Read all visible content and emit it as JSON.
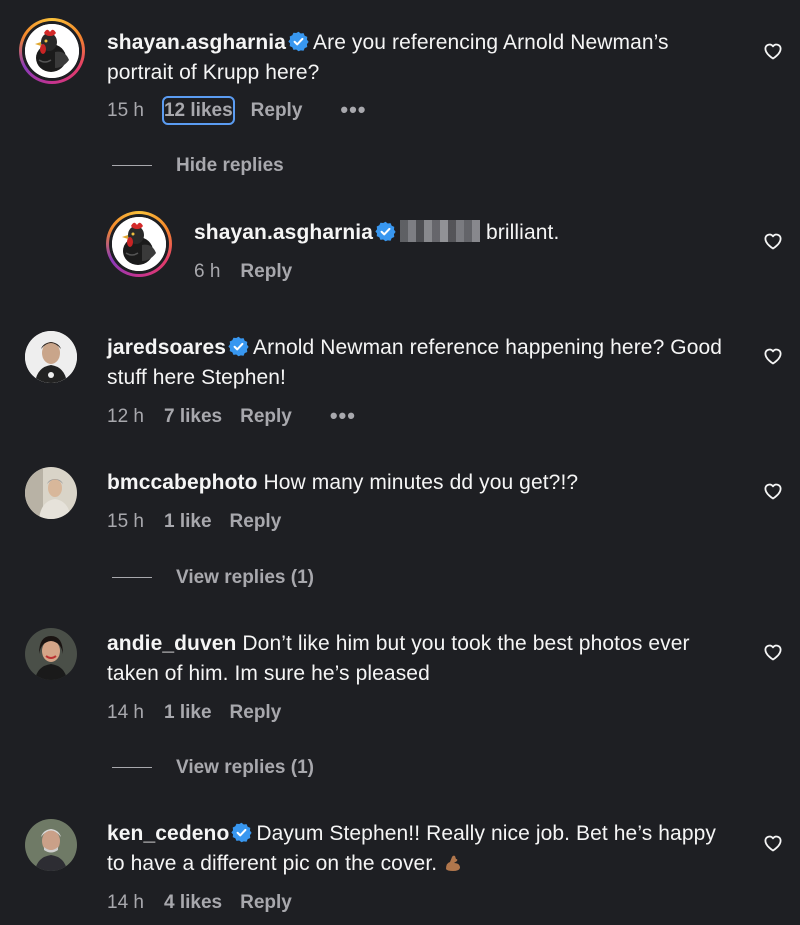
{
  "comments": [
    {
      "username": "shayan.asgharnia",
      "verified": true,
      "text": "Are you referencing Arnold Newman’s portrait of Krupp here?",
      "time": "15 h",
      "likes": "12 likes",
      "reply_label": "Reply",
      "more_label": "•••"
    },
    {
      "username": "shayan.asgharnia",
      "verified": true,
      "text": "brilliant.",
      "time": "6 h",
      "reply_label": "Reply"
    },
    {
      "username": "jaredsoares",
      "verified": true,
      "text": "Arnold Newman reference happening here? Good stuff here Stephen!",
      "time": "12 h",
      "likes": "7 likes",
      "reply_label": "Reply",
      "more_label": "•••"
    },
    {
      "username": "bmccabephoto",
      "verified": false,
      "text": "How many minutes dd you get?!?",
      "time": "15 h",
      "likes": "1 like",
      "reply_label": "Reply"
    },
    {
      "username": "andie_duven",
      "verified": false,
      "text": "Don’t like him but you took the best photos ever taken of him. Im sure he’s pleased",
      "time": "14 h",
      "likes": "1 like",
      "reply_label": "Reply"
    },
    {
      "username": "ken_cedeno",
      "verified": true,
      "text": "Dayum Stephen!! Really nice job. Bet he’s happy to have a different pic on the cover.",
      "time": "14 h",
      "likes": "4 likes",
      "reply_label": "Reply"
    }
  ],
  "hide_replies_label": "Hide replies",
  "view_replies_label": "View replies (1)",
  "colors": {
    "background": "#1e1f23",
    "verified_blue": "#3897f0",
    "muted_text": "#a8a8ad",
    "focus_outline": "#5b9cf2"
  }
}
